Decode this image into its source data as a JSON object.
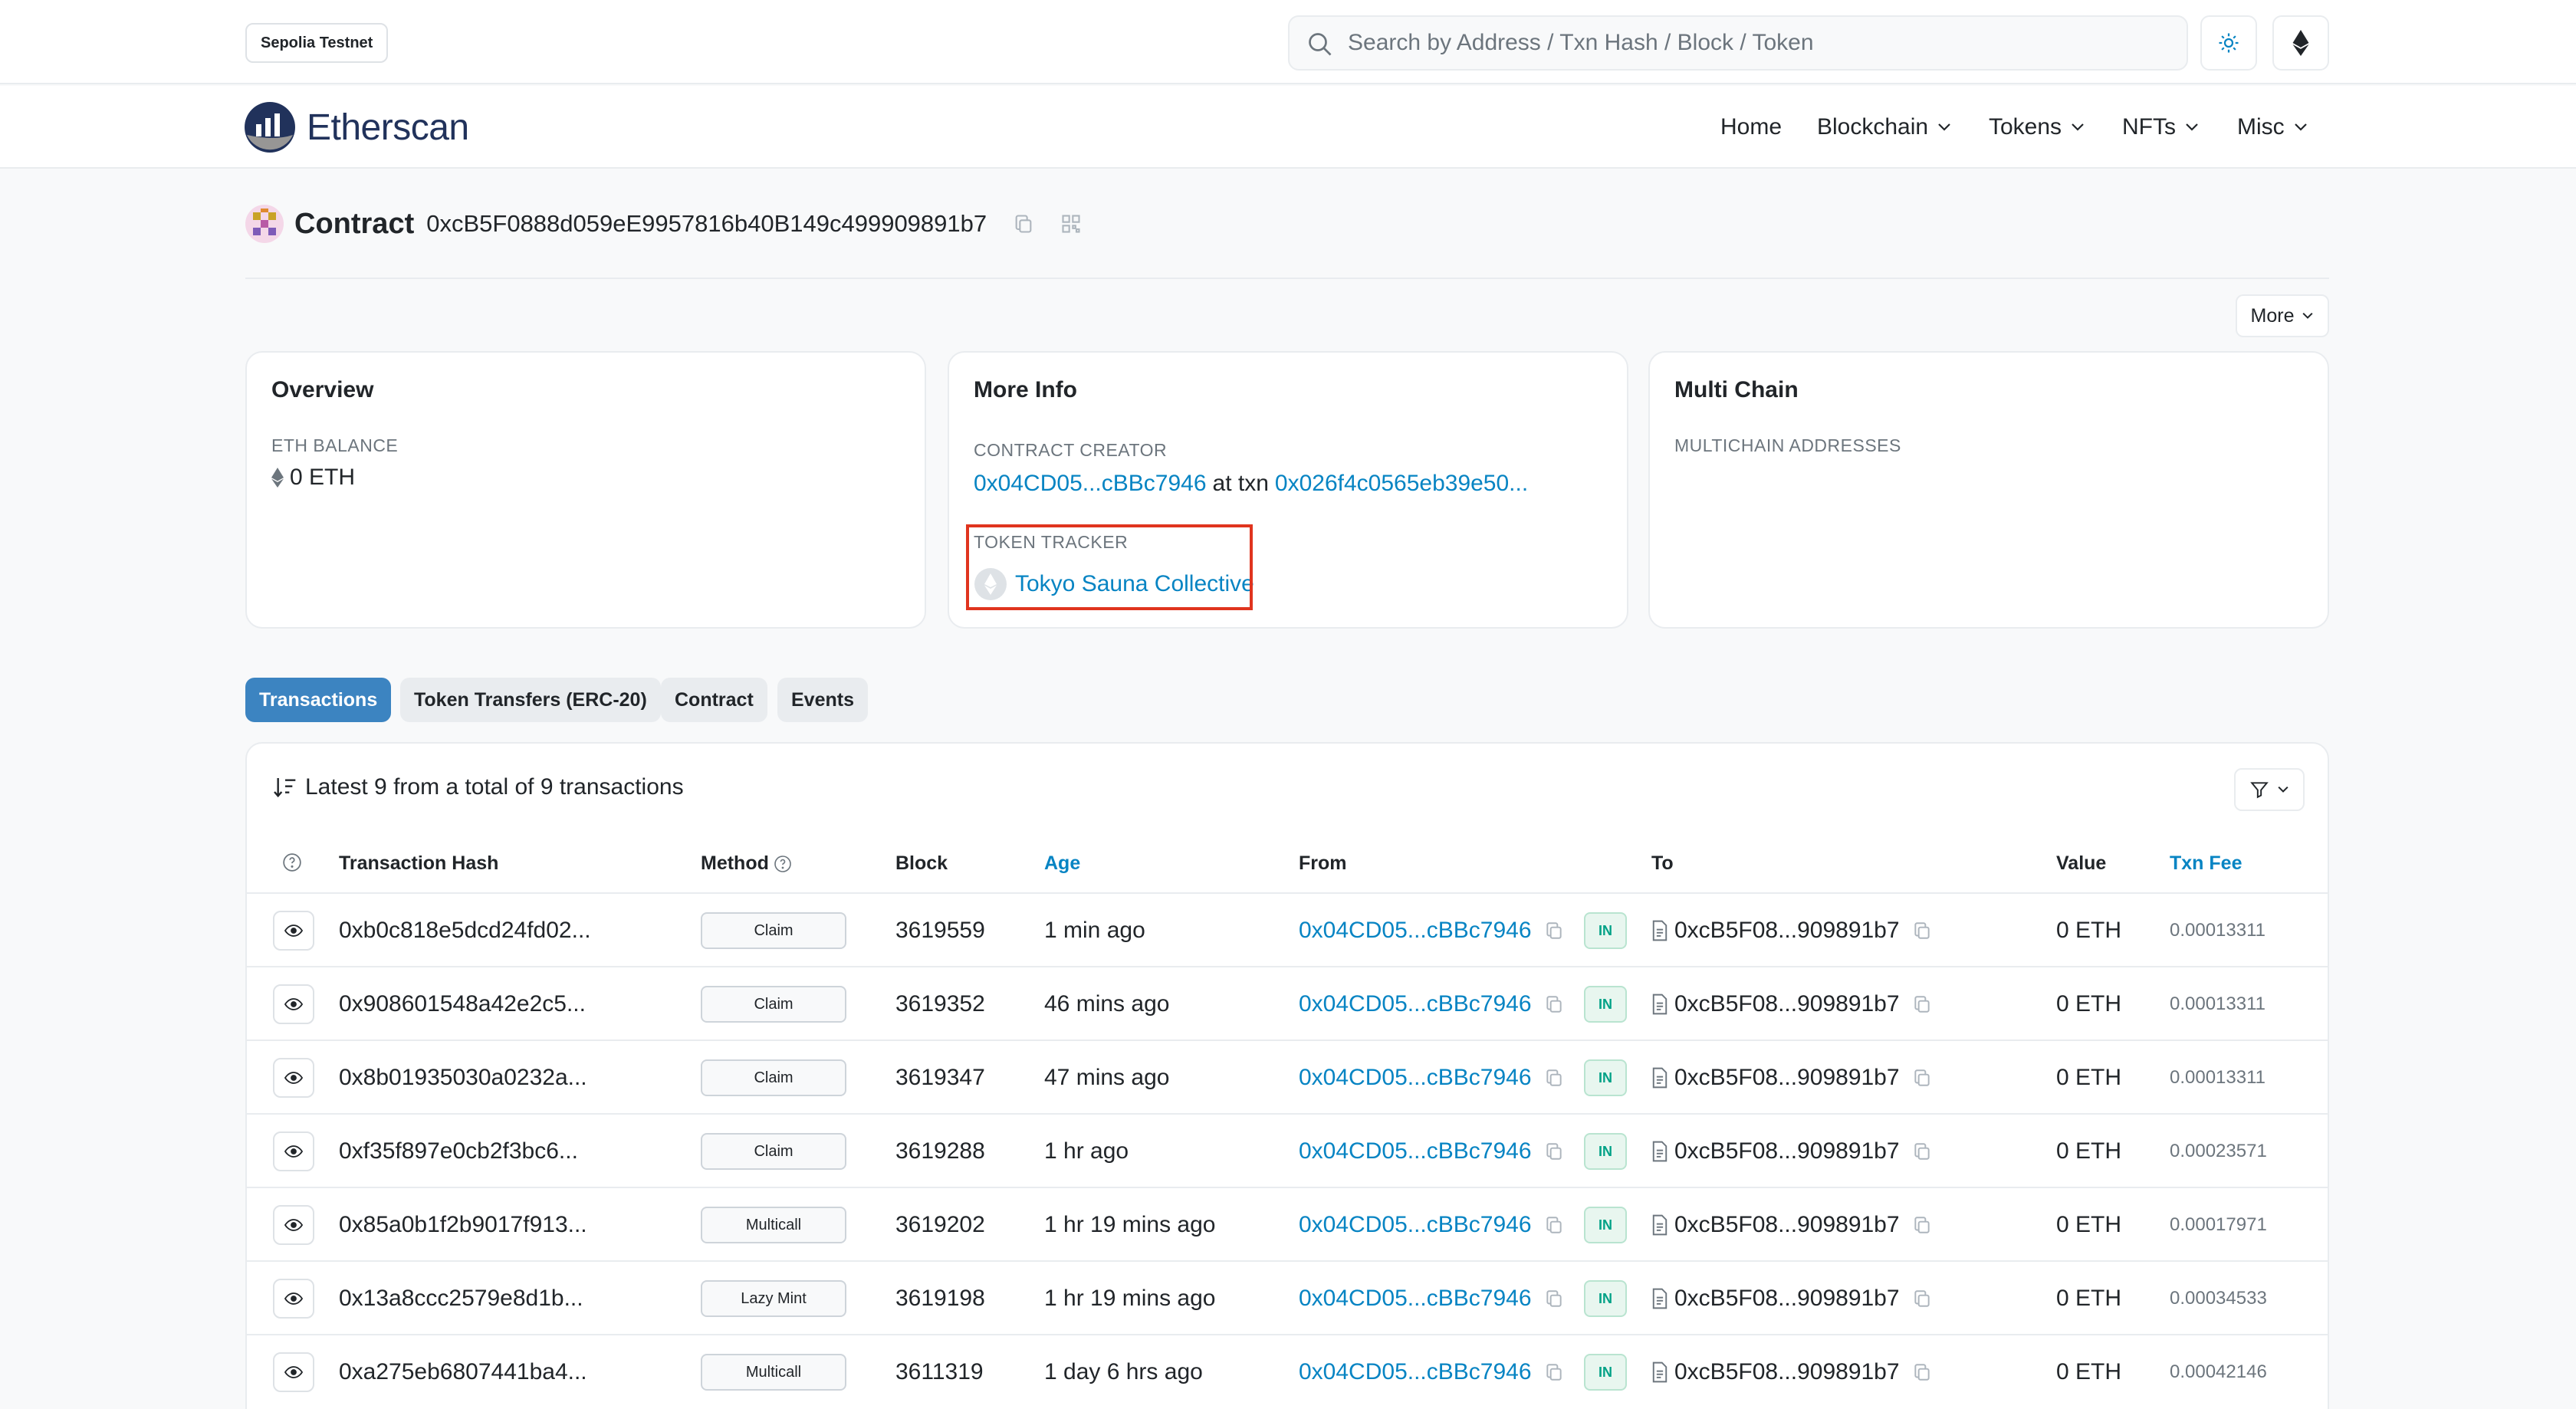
{
  "topbar": {
    "network_badge": "Sepolia Testnet",
    "search_placeholder": "Search by Address / Txn Hash / Block / Token"
  },
  "nav": {
    "brand": "Etherscan",
    "items": [
      {
        "label": "Home"
      },
      {
        "label": "Blockchain"
      },
      {
        "label": "Tokens"
      },
      {
        "label": "NFTs"
      },
      {
        "label": "Misc"
      }
    ]
  },
  "header": {
    "type_label": "Contract",
    "address": "0xcB5F0888d059eE9957816b40B149c499909891b7",
    "more_label": "More"
  },
  "overview": {
    "title": "Overview",
    "eth_balance_label": "ETH BALANCE",
    "eth_balance_value": "0 ETH"
  },
  "more_info": {
    "title": "More Info",
    "creator_label": "CONTRACT CREATOR",
    "creator_address": "0x04CD05...cBBc7946",
    "at_txn_text": "at txn",
    "creator_txn": "0x026f4c0565eb39e50...",
    "token_tracker_label": "TOKEN TRACKER",
    "token_tracker_name": "Tokyo Sauna Collective"
  },
  "multi_chain": {
    "title": "Multi Chain",
    "addresses_label": "MULTICHAIN ADDRESSES"
  },
  "tabs": [
    {
      "label": "Transactions",
      "active": true
    },
    {
      "label": "Token Transfers (ERC-20)",
      "active": false
    },
    {
      "label": "Contract",
      "active": false
    },
    {
      "label": "Events",
      "active": false
    }
  ],
  "transactions": {
    "summary": "Latest 9 from a total of 9 transactions",
    "columns": {
      "hash": "Transaction Hash",
      "method": "Method",
      "block": "Block",
      "age": "Age",
      "from": "From",
      "to": "To",
      "value": "Value",
      "fee": "Txn Fee"
    },
    "rows": [
      {
        "hash": "0xb0c818e5dcd24fd02...",
        "method": "Claim",
        "block": "3619559",
        "age": "1 min ago",
        "from": "0x04CD05...cBBc7946",
        "direction": "IN",
        "to": "0xcB5F08...909891b7",
        "value": "0 ETH",
        "fee": "0.00013311"
      },
      {
        "hash": "0x908601548a42e2c5...",
        "method": "Claim",
        "block": "3619352",
        "age": "46 mins ago",
        "from": "0x04CD05...cBBc7946",
        "direction": "IN",
        "to": "0xcB5F08...909891b7",
        "value": "0 ETH",
        "fee": "0.00013311"
      },
      {
        "hash": "0x8b01935030a0232a...",
        "method": "Claim",
        "block": "3619347",
        "age": "47 mins ago",
        "from": "0x04CD05...cBBc7946",
        "direction": "IN",
        "to": "0xcB5F08...909891b7",
        "value": "0 ETH",
        "fee": "0.00013311"
      },
      {
        "hash": "0xf35f897e0cb2f3bc6...",
        "method": "Claim",
        "block": "3619288",
        "age": "1 hr ago",
        "from": "0x04CD05...cBBc7946",
        "direction": "IN",
        "to": "0xcB5F08...909891b7",
        "value": "0 ETH",
        "fee": "0.00023571"
      },
      {
        "hash": "0x85a0b1f2b9017f913...",
        "method": "Multicall",
        "block": "3619202",
        "age": "1 hr 19 mins ago",
        "from": "0x04CD05...cBBc7946",
        "direction": "IN",
        "to": "0xcB5F08...909891b7",
        "value": "0 ETH",
        "fee": "0.00017971"
      },
      {
        "hash": "0x13a8ccc2579e8d1b...",
        "method": "Lazy Mint",
        "block": "3619198",
        "age": "1 hr 19 mins ago",
        "from": "0x04CD05...cBBc7946",
        "direction": "IN",
        "to": "0xcB5F08...909891b7",
        "value": "0 ETH",
        "fee": "0.00034533"
      },
      {
        "hash": "0xa275eb6807441ba4...",
        "method": "Multicall",
        "block": "3611319",
        "age": "1 day 6 hrs ago",
        "from": "0x04CD05...cBBc7946",
        "direction": "IN",
        "to": "0xcB5F08...909891b7",
        "value": "0 ETH",
        "fee": "0.00042146"
      }
    ]
  },
  "colors": {
    "link": "#0784c3",
    "active_tab": "#3c84c1",
    "highlight_box": "#e0341e",
    "in_badge": "#00a186"
  }
}
